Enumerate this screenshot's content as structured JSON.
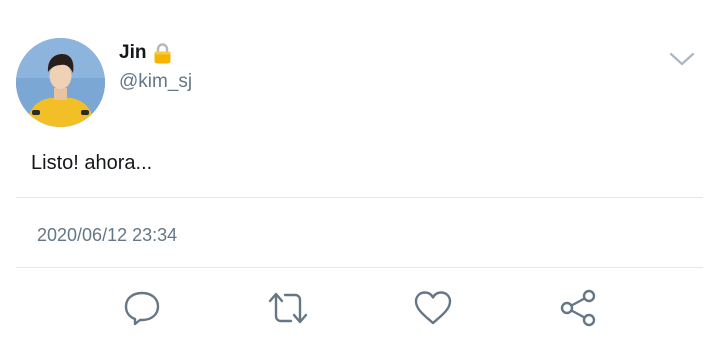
{
  "user": {
    "display_name": "Jin",
    "handle": "@kim_sj",
    "avatar_icon": "avatar-photo",
    "protected_icon": "lock-icon"
  },
  "tweet": {
    "text": "Listo! ahora...",
    "timestamp": "2020/06/12 23:34"
  },
  "actions": [
    {
      "name": "reply",
      "icon": "reply-icon"
    },
    {
      "name": "retweet",
      "icon": "retweet-icon"
    },
    {
      "name": "like",
      "icon": "heart-icon"
    },
    {
      "name": "share",
      "icon": "share-icon"
    }
  ],
  "colors": {
    "text": "#14171a",
    "secondary": "#657786",
    "icon": "#657786",
    "divider": "#e1e8ed",
    "lock": "#f4b400",
    "avatar_bg": "#7aa6d3",
    "shirt": "#f2c026"
  }
}
